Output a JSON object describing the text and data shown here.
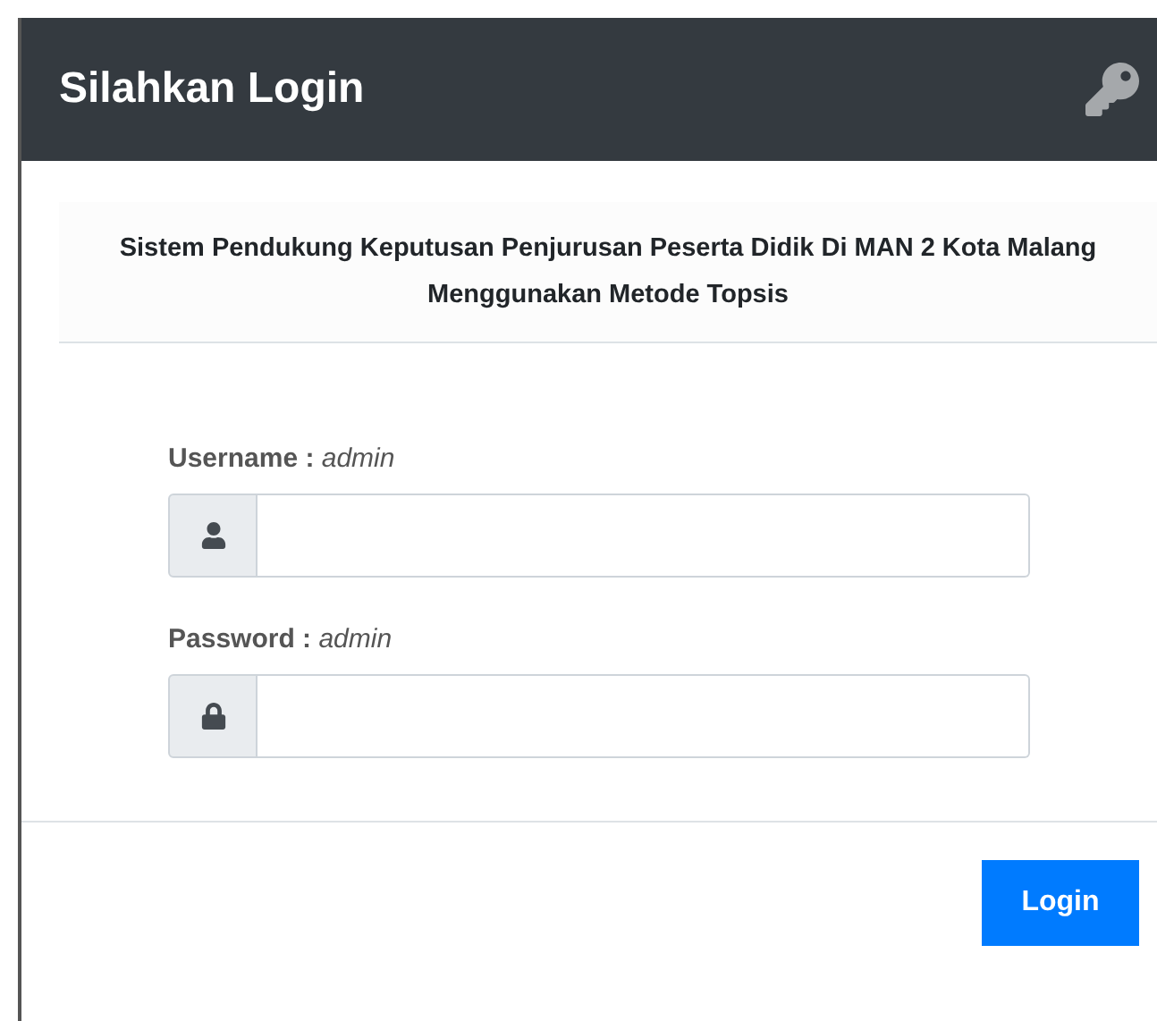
{
  "header": {
    "title": "Silahkan Login"
  },
  "intro": {
    "text": "Sistem Pendukung Keputusan Penjurusan Peserta Didik Di MAN 2 Kota Malang Menggunakan Metode Topsis"
  },
  "fields": [
    {
      "kind": "user",
      "label": "**Username :** *admin*"
    },
    {
      "kind": "password",
      "label": "**Password :** *admin*"
    }
  ],
  "buttons": [
    {
      "label": "Login"
    }
  ]
}
